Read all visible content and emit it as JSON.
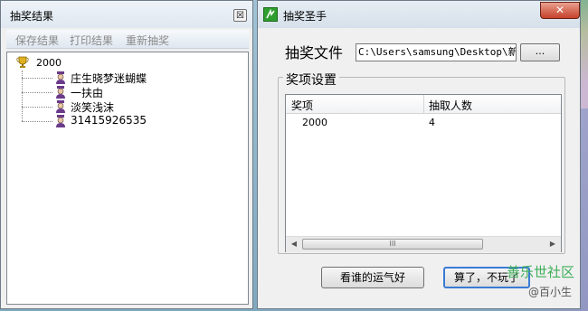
{
  "left_window": {
    "title": "抽奖结果",
    "close_glyph": "☒",
    "menu": [
      "保存结果",
      "打印结果",
      "重新抽奖"
    ],
    "tree": {
      "root_label": "2000",
      "root_icon": "trophy-icon",
      "children": [
        "庄生晓梦迷蝴蝶",
        "一扶由",
        "淡笑浅沫",
        "31415926535"
      ],
      "child_icon": "user-avatar-icon"
    }
  },
  "right_window": {
    "title": "抽奖圣手",
    "close_glyph": "✕",
    "file_label": "抽奖文件",
    "file_path": "C:\\Users\\samsung\\Desktop\\新建",
    "browse_label": "...",
    "group_title": "奖项设置",
    "table": {
      "columns": [
        "奖项",
        "抽取人数"
      ],
      "rows": [
        [
          "2000",
          "4"
        ]
      ]
    },
    "scroll_left": "◀",
    "scroll_right": "▶",
    "scroll_grip": "III",
    "buttons": {
      "draw": "看谁的运气好",
      "quit": "算了，不玩了"
    }
  },
  "watermark": {
    "line1": "善乐世社区",
    "line2": "@百小生"
  },
  "colors": {
    "close_red": "#c6412b",
    "app_icon_green": "#2e9e2e",
    "focus_blue": "#3a7bd5"
  }
}
